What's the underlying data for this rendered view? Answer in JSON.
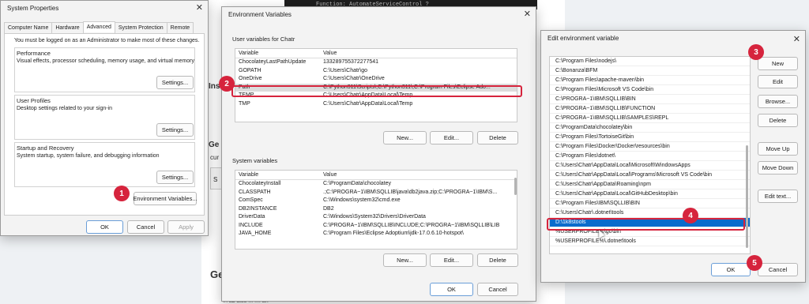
{
  "background": {
    "terminal_line": "Function: AutomateServiceControl ?",
    "frag_ins": "Ins",
    "frag_ge": "Ge",
    "frag_cur": "cur",
    "frag_s": "S",
    "frag_ge2": "Ge",
    "bottom_text": "In ab also ...  ....  an"
  },
  "system_properties": {
    "title": "System Properties",
    "tabs": [
      "Computer Name",
      "Hardware",
      "Advanced",
      "System Protection",
      "Remote"
    ],
    "active_tab": "Advanced",
    "admin_note": "You must be logged on as an Administrator to make most of these changes.",
    "performance": {
      "title": "Performance",
      "desc": "Visual effects, processor scheduling, memory usage, and virtual memory",
      "button": "Settings..."
    },
    "user_profiles": {
      "title": "User Profiles",
      "desc": "Desktop settings related to your sign-in",
      "button": "Settings..."
    },
    "startup": {
      "title": "Startup and Recovery",
      "desc": "System startup, system failure, and debugging information",
      "button": "Settings..."
    },
    "env_button": "Environment Variables...",
    "ok": "OK",
    "cancel": "Cancel",
    "apply": "Apply"
  },
  "env_vars": {
    "title": "Environment Variables",
    "user_section": "User variables for Chatr",
    "col_variable": "Variable",
    "col_value": "Value",
    "user_rows": [
      {
        "name": "ChocolateyLastPathUpdate",
        "value": "133289755372277541"
      },
      {
        "name": "GOPATH",
        "value": "C:\\Users\\Chatr\\go"
      },
      {
        "name": "OneDrive",
        "value": "C:\\Users\\Chatr\\OneDrive"
      },
      {
        "name": "Path",
        "value": "C:\\Python311\\Scripts\\;C:\\Python311\\;C:\\Program Files\\Eclipse Ado..."
      },
      {
        "name": "TEMP",
        "value": "C:\\Users\\Chatr\\AppData\\Local\\Temp"
      },
      {
        "name": "TMP",
        "value": "C:\\Users\\Chatr\\AppData\\Local\\Temp"
      }
    ],
    "system_section": "System variables",
    "system_rows": [
      {
        "name": "ChocolateyInstall",
        "value": "C:\\ProgramData\\chocolatey"
      },
      {
        "name": "CLASSPATH",
        "value": ".;C:\\PROGRA~1\\IBM\\SQLLIB\\java\\db2java.zip;C:\\PROGRA~1\\IBM\\S..."
      },
      {
        "name": "ComSpec",
        "value": "C:\\Windows\\system32\\cmd.exe"
      },
      {
        "name": "DB2INSTANCE",
        "value": "DB2"
      },
      {
        "name": "DriverData",
        "value": "C:\\Windows\\System32\\Drivers\\DriverData"
      },
      {
        "name": "INCLUDE",
        "value": "C:\\PROGRA~1\\IBM\\SQLLIB\\INCLUDE;C:\\PROGRA~1\\IBM\\SQLLIB\\LIB"
      },
      {
        "name": "JAVA_HOME",
        "value": "C:\\Program Files\\Eclipse Adoptium\\jdk-17.0.6.10-hotspot\\"
      }
    ],
    "new": "New...",
    "edit": "Edit...",
    "delete": "Delete",
    "ok": "OK",
    "cancel": "Cancel"
  },
  "edit_env": {
    "title": "Edit environment variable",
    "items": [
      "C:\\Program Files\\nodejs\\",
      "C:\\Bonanza\\BFM",
      "C:\\Program Files\\apache-maven\\bin",
      "C:\\Program Files\\Microsoft VS Code\\bin",
      "C:\\PROGRA~1\\IBM\\SQLLIB\\BIN",
      "C:\\PROGRA~1\\IBM\\SQLLIB\\FUNCTION",
      "C:\\PROGRA~1\\IBM\\SQLLIB\\SAMPLES\\REPL",
      "C:\\ProgramData\\chocolatey\\bin",
      "C:\\Program Files\\TortoiseGit\\bin",
      "C:\\Program Files\\Docker\\Docker\\resources\\bin",
      "C:\\Program Files\\dotnet\\",
      "C:\\Users\\Chatr\\AppData\\Local\\Microsoft\\WindowsApps",
      "C:\\Users\\Chatr\\AppData\\Local\\Programs\\Microsoft VS Code\\bin",
      "C:\\Users\\Chatr\\AppData\\Roaming\\npm",
      "C:\\Users\\Chatr\\AppData\\Local\\GitHubDesktop\\bin",
      "C:\\Program Files\\IBM\\SQLLIB\\BIN",
      "C:\\Users\\Chatr\\.dotnet\\tools",
      "D:\\1k8stools",
      "%USERPROFILE%\\go\\bin",
      "%USERPROFILE%\\.dotnet\\tools"
    ],
    "selected_index": 17,
    "buttons": {
      "new": "New",
      "edit": "Edit",
      "browse": "Browse...",
      "delete": "Delete",
      "move_up": "Move Up",
      "move_down": "Move Down",
      "edit_text": "Edit text..."
    },
    "ok": "OK",
    "cancel": "Cancel"
  },
  "badges": [
    "1",
    "2",
    "3",
    "4",
    "5"
  ],
  "colors": {
    "highlight": "#d6243d",
    "selection": "#0a6ccc"
  }
}
